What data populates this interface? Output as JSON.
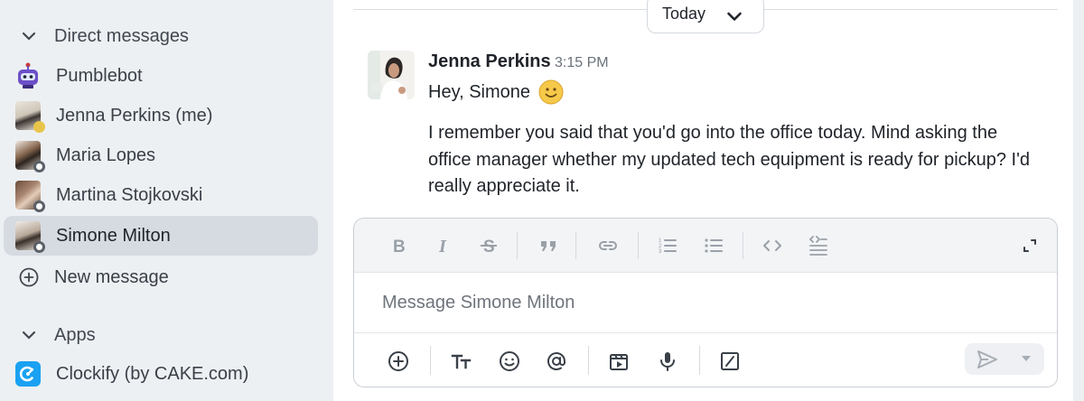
{
  "sidebar": {
    "direct_messages_label": "Direct messages",
    "contacts": [
      {
        "name": "Pumblebot"
      },
      {
        "name": "Jenna Perkins (me)"
      },
      {
        "name": "Maria Lopes"
      },
      {
        "name": "Martina Stojkovski"
      },
      {
        "name": "Simone Milton"
      }
    ],
    "new_message_label": "New message",
    "apps_label": "Apps",
    "apps": [
      {
        "name": "Clockify (by CAKE.com)"
      }
    ]
  },
  "divider": {
    "date_label": "Today"
  },
  "message": {
    "author": "Jenna Perkins",
    "time": "3:15 PM",
    "greeting": "Hey, Simone",
    "body": "I remember you said that you'd go into the office today. Mind asking the office manager whether my updated tech equipment is ready for pickup? I'd really appreciate it."
  },
  "composer": {
    "placeholder": "Message Simone Milton",
    "value": ""
  },
  "colors": {
    "sidebar_bg": "#edf0f3",
    "active_item_bg": "#d6dbe1",
    "accent_blue": "#1aa1f2",
    "bot_purple": "#6b4fc8"
  }
}
